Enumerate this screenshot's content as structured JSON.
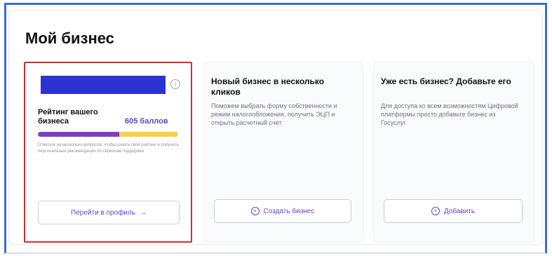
{
  "page": {
    "title": "Мой бизнес"
  },
  "rating_card": {
    "label": "Рейтинг вашего бизнеса",
    "score": "605 баллов",
    "progress": 0.58,
    "note": "Ответьте на несколько вопросов, чтобы узнать свой рейтинг и получить персональные рекомендации по сервисам поддержки",
    "button_label": "Перейти в профиль",
    "button_arrow": "→",
    "info_glyph": "i"
  },
  "new_business_card": {
    "title": "Новый бизнес в несколько кликов",
    "description": "Поможем выбрать форму собственности и режим налогообложения, получить ЭЦП и открыть расчетный счет",
    "button_label": "Создать бизнес"
  },
  "existing_business_card": {
    "title": "Уже есть бизнес? Добавьте его",
    "description": "Для доступа ко всем возможностям Цифровой платформы просто добавьте бизнес из Госуслуг",
    "button_label": "Добавить"
  },
  "icons": {
    "info": "info-icon",
    "plus": "plus-circle-icon",
    "arrow": "arrow-right-icon"
  },
  "colors": {
    "accent": "#5a49c9",
    "bar_blue": "#2d33d3",
    "progress_purple": "#7d3fc2",
    "progress_yellow": "#f4d24a",
    "highlight_red": "#d62b2b"
  }
}
